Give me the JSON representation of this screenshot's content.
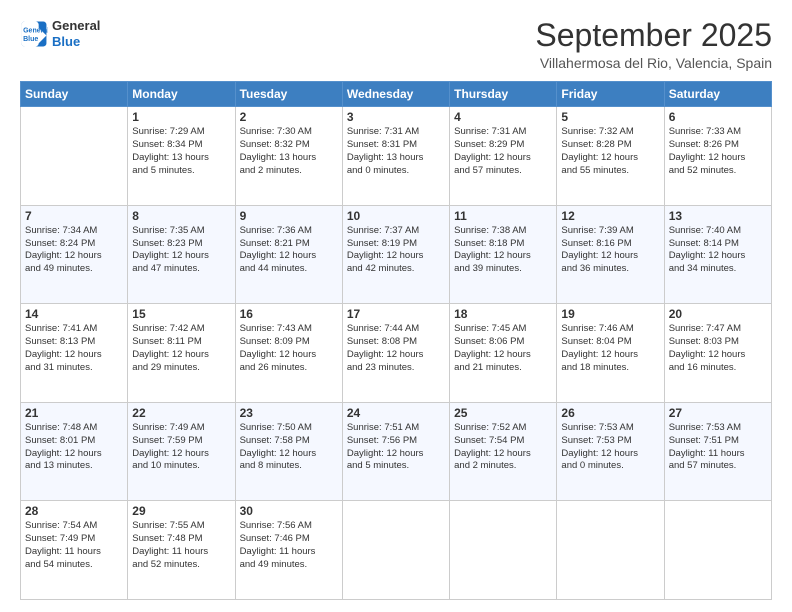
{
  "header": {
    "logo_line1": "General",
    "logo_line2": "Blue",
    "title": "September 2025",
    "subtitle": "Villahermosa del Rio, Valencia, Spain"
  },
  "days_of_week": [
    "Sunday",
    "Monday",
    "Tuesday",
    "Wednesday",
    "Thursday",
    "Friday",
    "Saturday"
  ],
  "weeks": [
    [
      {
        "day": "",
        "info": ""
      },
      {
        "day": "1",
        "info": "Sunrise: 7:29 AM\nSunset: 8:34 PM\nDaylight: 13 hours\nand 5 minutes."
      },
      {
        "day": "2",
        "info": "Sunrise: 7:30 AM\nSunset: 8:32 PM\nDaylight: 13 hours\nand 2 minutes."
      },
      {
        "day": "3",
        "info": "Sunrise: 7:31 AM\nSunset: 8:31 PM\nDaylight: 13 hours\nand 0 minutes."
      },
      {
        "day": "4",
        "info": "Sunrise: 7:31 AM\nSunset: 8:29 PM\nDaylight: 12 hours\nand 57 minutes."
      },
      {
        "day": "5",
        "info": "Sunrise: 7:32 AM\nSunset: 8:28 PM\nDaylight: 12 hours\nand 55 minutes."
      },
      {
        "day": "6",
        "info": "Sunrise: 7:33 AM\nSunset: 8:26 PM\nDaylight: 12 hours\nand 52 minutes."
      }
    ],
    [
      {
        "day": "7",
        "info": "Sunrise: 7:34 AM\nSunset: 8:24 PM\nDaylight: 12 hours\nand 49 minutes."
      },
      {
        "day": "8",
        "info": "Sunrise: 7:35 AM\nSunset: 8:23 PM\nDaylight: 12 hours\nand 47 minutes."
      },
      {
        "day": "9",
        "info": "Sunrise: 7:36 AM\nSunset: 8:21 PM\nDaylight: 12 hours\nand 44 minutes."
      },
      {
        "day": "10",
        "info": "Sunrise: 7:37 AM\nSunset: 8:19 PM\nDaylight: 12 hours\nand 42 minutes."
      },
      {
        "day": "11",
        "info": "Sunrise: 7:38 AM\nSunset: 8:18 PM\nDaylight: 12 hours\nand 39 minutes."
      },
      {
        "day": "12",
        "info": "Sunrise: 7:39 AM\nSunset: 8:16 PM\nDaylight: 12 hours\nand 36 minutes."
      },
      {
        "day": "13",
        "info": "Sunrise: 7:40 AM\nSunset: 8:14 PM\nDaylight: 12 hours\nand 34 minutes."
      }
    ],
    [
      {
        "day": "14",
        "info": "Sunrise: 7:41 AM\nSunset: 8:13 PM\nDaylight: 12 hours\nand 31 minutes."
      },
      {
        "day": "15",
        "info": "Sunrise: 7:42 AM\nSunset: 8:11 PM\nDaylight: 12 hours\nand 29 minutes."
      },
      {
        "day": "16",
        "info": "Sunrise: 7:43 AM\nSunset: 8:09 PM\nDaylight: 12 hours\nand 26 minutes."
      },
      {
        "day": "17",
        "info": "Sunrise: 7:44 AM\nSunset: 8:08 PM\nDaylight: 12 hours\nand 23 minutes."
      },
      {
        "day": "18",
        "info": "Sunrise: 7:45 AM\nSunset: 8:06 PM\nDaylight: 12 hours\nand 21 minutes."
      },
      {
        "day": "19",
        "info": "Sunrise: 7:46 AM\nSunset: 8:04 PM\nDaylight: 12 hours\nand 18 minutes."
      },
      {
        "day": "20",
        "info": "Sunrise: 7:47 AM\nSunset: 8:03 PM\nDaylight: 12 hours\nand 16 minutes."
      }
    ],
    [
      {
        "day": "21",
        "info": "Sunrise: 7:48 AM\nSunset: 8:01 PM\nDaylight: 12 hours\nand 13 minutes."
      },
      {
        "day": "22",
        "info": "Sunrise: 7:49 AM\nSunset: 7:59 PM\nDaylight: 12 hours\nand 10 minutes."
      },
      {
        "day": "23",
        "info": "Sunrise: 7:50 AM\nSunset: 7:58 PM\nDaylight: 12 hours\nand 8 minutes."
      },
      {
        "day": "24",
        "info": "Sunrise: 7:51 AM\nSunset: 7:56 PM\nDaylight: 12 hours\nand 5 minutes."
      },
      {
        "day": "25",
        "info": "Sunrise: 7:52 AM\nSunset: 7:54 PM\nDaylight: 12 hours\nand 2 minutes."
      },
      {
        "day": "26",
        "info": "Sunrise: 7:53 AM\nSunset: 7:53 PM\nDaylight: 12 hours\nand 0 minutes."
      },
      {
        "day": "27",
        "info": "Sunrise: 7:53 AM\nSunset: 7:51 PM\nDaylight: 11 hours\nand 57 minutes."
      }
    ],
    [
      {
        "day": "28",
        "info": "Sunrise: 7:54 AM\nSunset: 7:49 PM\nDaylight: 11 hours\nand 54 minutes."
      },
      {
        "day": "29",
        "info": "Sunrise: 7:55 AM\nSunset: 7:48 PM\nDaylight: 11 hours\nand 52 minutes."
      },
      {
        "day": "30",
        "info": "Sunrise: 7:56 AM\nSunset: 7:46 PM\nDaylight: 11 hours\nand 49 minutes."
      },
      {
        "day": "",
        "info": ""
      },
      {
        "day": "",
        "info": ""
      },
      {
        "day": "",
        "info": ""
      },
      {
        "day": "",
        "info": ""
      }
    ]
  ]
}
